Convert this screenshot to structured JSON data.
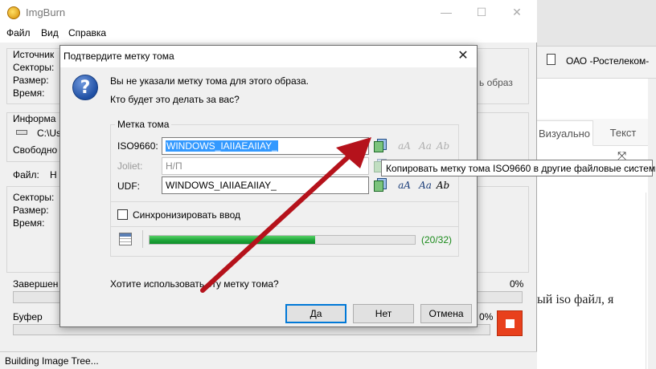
{
  "browser": {
    "tab_title": "ОАО -Ростелеком-",
    "editor_tabs": [
      "Визуально",
      "Текст"
    ],
    "paragraph_fragment": "ый iso файл, я"
  },
  "imgburn": {
    "title": "ImgBurn",
    "menu": [
      "Файл",
      "Вид",
      "Справка"
    ],
    "source_group": {
      "title": "Источник",
      "sectors_label": "Секторы:",
      "size_label": "Размер:",
      "time_label": "Время:",
      "right_fragment": "ь образ"
    },
    "info_group": {
      "title": "Информа",
      "drive_value": "C:\\Us",
      "free_label": "Свободно"
    },
    "file_label": "Файл:",
    "file_value": "Н",
    "dest": {
      "sectors_label": "Секторы:",
      "size_label": "Размер:",
      "time_label": "Время:"
    },
    "complete_label": "Завершен",
    "complete_percent": "0%",
    "buffer_label": "Буфер",
    "buffer_percent": "0%",
    "status_text": "Building Image Tree..."
  },
  "dialog": {
    "title": "Подтвердите метку тома",
    "message_line1": "Вы не указали метку тома для этого образа.",
    "message_line2": "Кто будет это делать за вас?",
    "group_title": "Метка тома",
    "iso_label": "ISO9660:",
    "iso_value": "WINDOWS_IAIIAEAIIAY_",
    "joliet_label": "Joliet:",
    "joliet_value": "Н/П",
    "udf_label": "UDF:",
    "udf_value": "WINDOWS_IAIIAEAIIAY_",
    "sync_label": "Синхронизировать ввод",
    "sync_checked": false,
    "progress_fraction": 0.625,
    "progress_text": "(20/32)",
    "question": "Хотите использовать эту метку тома?",
    "buttons": {
      "yes": "Да",
      "no": "Нет",
      "cancel": "Отмена"
    },
    "tooltip": "Копировать метку тома ISO9660 в другие файловые системы",
    "icon_glyphs": {
      "lowercase": "aA",
      "titlecase": "Aa",
      "bold": "Ab",
      "question": "?"
    }
  },
  "colors": {
    "selection": "#3399ff",
    "progress_green": "#1ea53a",
    "stop_button": "#e8401c",
    "annotation_arrow": "#b5121b"
  }
}
